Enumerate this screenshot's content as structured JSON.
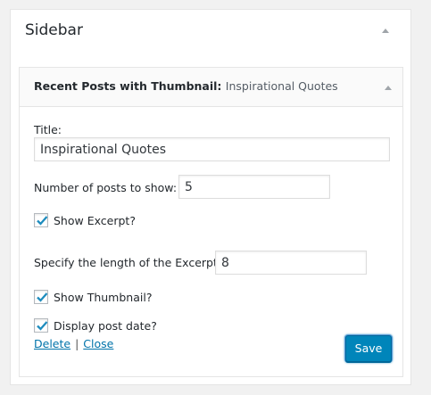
{
  "sidebar": {
    "title": "Sidebar"
  },
  "widget": {
    "name": "Recent Posts with Thumbnail:",
    "instance_title": "Inspirational Quotes",
    "fields": {
      "title_label": "Title:",
      "title_value": "Inspirational Quotes",
      "num_posts_label": "Number of posts to show:",
      "num_posts_value": "5",
      "show_excerpt_label": "Show Excerpt?",
      "show_excerpt_checked": true,
      "excerpt_length_label": "Specify the length of the Excerpt:",
      "excerpt_length_value": "8",
      "show_thumbnail_label": "Show Thumbnail?",
      "show_thumbnail_checked": true,
      "display_date_label": "Display post date?",
      "display_date_checked": true
    },
    "actions": {
      "delete_label": "Delete",
      "separator": "|",
      "close_label": "Close",
      "save_label": "Save"
    }
  },
  "colors": {
    "accent": "#0085ba",
    "link": "#0073aa",
    "check": "#1e8cbe"
  },
  "icons": {
    "collapse": "arrow-up-icon",
    "check": "checkmark-icon"
  }
}
